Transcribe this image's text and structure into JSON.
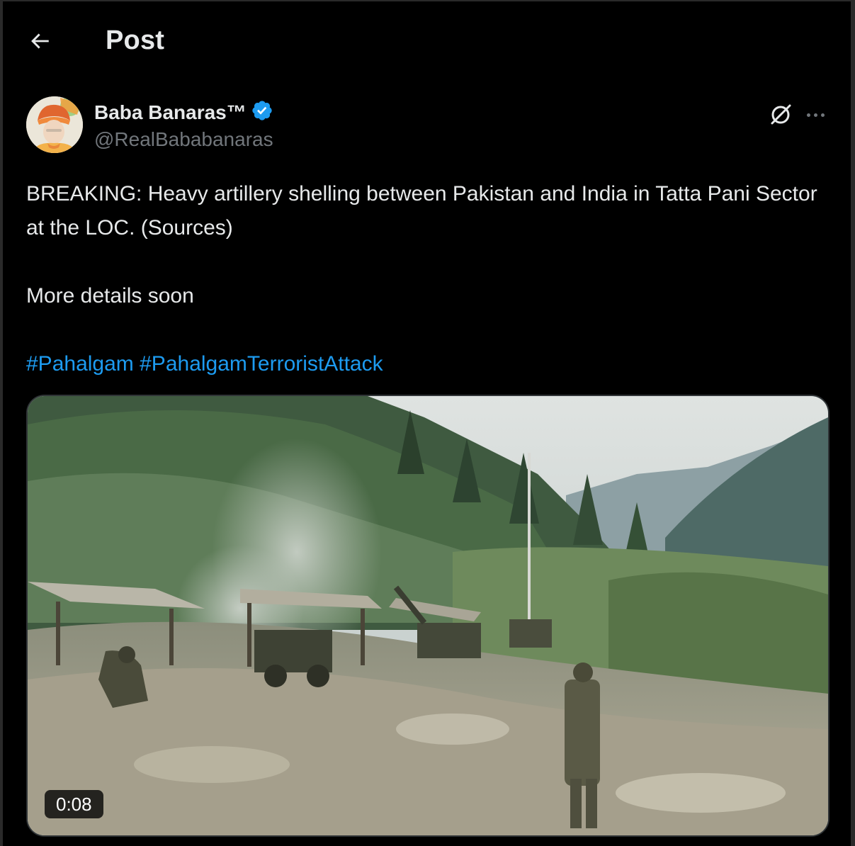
{
  "header": {
    "back_icon": "arrow-left-icon",
    "title": "Post"
  },
  "post": {
    "author": {
      "display_name": "Baba Banaras™",
      "handle": "@RealBababanaras",
      "verified": true,
      "verified_color": "#1d9bf0"
    },
    "actions": {
      "grok_icon": "grok-icon",
      "more_icon": "more-horizontal-icon"
    },
    "text": {
      "line1": "BREAKING: Heavy artillery shelling between Pakistan and India in Tatta Pani Sector at the LOC. (Sources)",
      "line2": "More details soon",
      "hashtags": [
        "#Pahalgam",
        "#PahalgamTerroristAttack"
      ]
    },
    "media": {
      "type": "video",
      "duration": "0:08"
    }
  },
  "colors": {
    "background": "#000000",
    "text_primary": "#e7e9ea",
    "text_secondary": "#71767b",
    "link": "#1d9bf0"
  }
}
